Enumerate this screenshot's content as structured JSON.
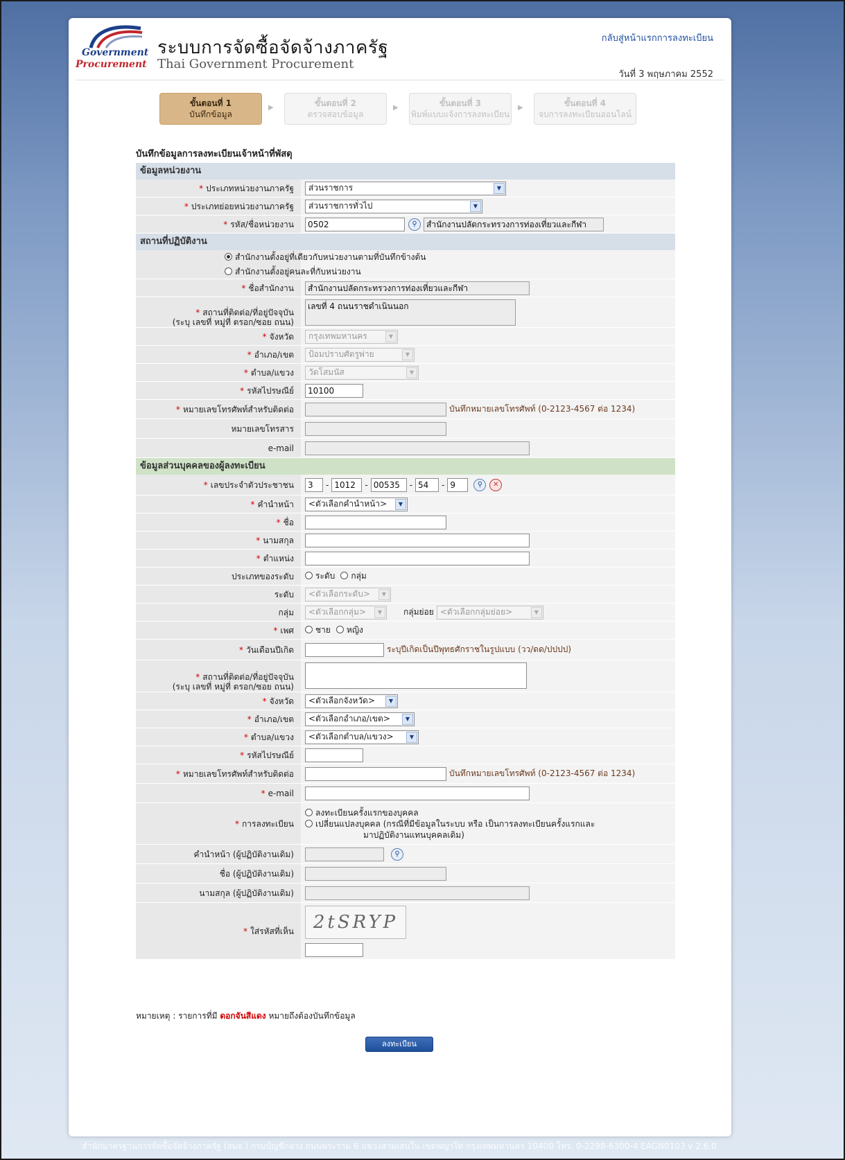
{
  "header": {
    "logo_line1": "Government",
    "logo_line2": "Procurement",
    "title_th": "ระบบการจัดซื้อจัดจ้างภาครัฐ",
    "title_en": "Thai Government Procurement",
    "back_link": "กลับสู่หน้าแรกการลงทะเบียน",
    "date": "วันที่ 3 พฤษภาคม 2552"
  },
  "steps": [
    {
      "title": "ขั้นตอนที่ 1",
      "sub": "บันทึกข้อมูล"
    },
    {
      "title": "ขั้นตอนที่ 2",
      "sub": "ตรวจสอบข้อมูล"
    },
    {
      "title": "ขั้นตอนที่ 3",
      "sub": "พิมพ์แบบแจ้งการลงทะเบียน"
    },
    {
      "title": "ขั้นตอนที่ 4",
      "sub": "จบการลงทะเบียนออนไลน์"
    }
  ],
  "form_title": "บันทึกข้อมูลการลงทะเบียนเจ้าหน้าที่พัสดุ",
  "agency": {
    "section": "ข้อมูลหน่วยงาน",
    "type_label": "ประเภทหน่วยงานภาครัฐ",
    "type_value": "ส่วนราชการ",
    "subtype_label": "ประเภทย่อยหน่วยงานภาครัฐ",
    "subtype_value": "ส่วนราชการทั่วไป",
    "code_label": "รหัส/ชื่อหน่วยงาน",
    "code_value": "0502",
    "name_value": "สำนักงานปลัดกระทรวงการท่องเที่ยวและกีฬา"
  },
  "office": {
    "section": "สถานที่ปฏิบัติงาน",
    "radio1": "สำนักงานตั้งอยู่ที่เดียวกับหน่วยงานตามที่บันทึกข้างต้น",
    "radio2": "สำนักงานตั้งอยู่คนละที่กับหน่วยงาน",
    "name_label": "ชื่อสำนักงาน",
    "name_value": "สำนักงานปลัดกระทรวงการท่องเที่ยวและกีฬา",
    "addr_label": "สถานที่ติดต่อ/ที่อยู่ปัจจุบัน",
    "addr_label2": "(ระบุ เลขที่ หมู่ที่ ตรอก/ซอย ถนน)",
    "addr_value": "เลขที่ 4  ถนนราชดำเนินนอก",
    "province_label": "จังหวัด",
    "province_value": "กรุงเทพมหานคร",
    "district_label": "อำเภอ/เขต",
    "district_value": "ป้อมปราบศัตรูพ่าย",
    "subdistrict_label": "ตำบล/แขวง",
    "subdistrict_value": "วัดโสมนัส",
    "zip_label": "รหัสไปรษณีย์",
    "zip_value": "10100",
    "phone_label": "หมายเลขโทรศัพท์สำหรับติดต่อ",
    "phone_hint": "บันทึกหมายเลขโทรศัพท์ (0-2123-4567 ต่อ 1234)",
    "fax_label": "หมายเลขโทรสาร",
    "email_label": "e-mail"
  },
  "person": {
    "section": "ข้อมูลส่วนบุคคลของผู้ลงทะเบียน",
    "id_label": "เลขประจำตัวประชาชน",
    "id_parts": [
      "3",
      "1012",
      "00535",
      "54",
      "9"
    ],
    "prefix_label": "คำนำหน้า",
    "prefix_value": "<ตัวเลือกคำนำหน้า>",
    "first_label": "ชื่อ",
    "last_label": "นามสกุล",
    "position_label": "ตำแหน่ง",
    "level_type_label": "ประเภทของระดับ",
    "level_type_opt1": "ระดับ",
    "level_type_opt2": "กลุ่ม",
    "level_label": "ระดับ",
    "level_value": "<ตัวเลือกระดับ>",
    "group_label": "กลุ่ม",
    "group_value": "<ตัวเลือกกลุ่ม>",
    "subgroup_label": "กลุ่มย่อย",
    "subgroup_value": "<ตัวเลือกกลุ่มย่อย>",
    "gender_label": "เพศ",
    "gender_opt1": "ชาย",
    "gender_opt2": "หญิง",
    "dob_label": "วันเดือนปีเกิด",
    "dob_hint": "ระบุปีเกิดเป็นปีพุทธศักราชในรูปแบบ (วว/ดด/ปปปป)",
    "addr_label": "สถานที่ติดต่อ/ที่อยู่ปัจจุบัน",
    "addr_label2": "(ระบุ เลขที่ หมู่ที่ ตรอก/ซอย ถนน)",
    "province_label": "จังหวัด",
    "province_value": "<ตัวเลือกจังหวัด>",
    "district_label": "อำเภอ/เขต",
    "district_value": "<ตัวเลือกอำเภอ/เขต>",
    "subdistrict_label": "ตำบล/แขวง",
    "subdistrict_value": "<ตัวเลือกตำบล/แขวง>",
    "zip_label": "รหัสไปรษณีย์",
    "phone_label": "หมายเลขโทรศัพท์สำหรับติดต่อ",
    "phone_hint": "บันทึกหมายเลขโทรศัพท์ (0-2123-4567 ต่อ 1234)",
    "email_label": "e-mail",
    "reg_label": "การลงทะเบียน",
    "reg_opt1": "ลงทะเบียนครั้งแรกของบุคคล",
    "reg_opt2": "เปลี่ยนแปลงบุคคล (กรณีที่มีข้อมูลในระบบ หรือ เป็นการลงทะเบียนครั้งแรกและ",
    "reg_opt2b": "มาปฏิบัติงานแทนบุคคลเดิม)",
    "old_prefix_label": "คำนำหน้า (ผู้ปฏิบัติงานเดิม)",
    "old_first_label": "ชื่อ (ผู้ปฏิบัติงานเดิม)",
    "old_last_label": "นามสกุล (ผู้ปฏิบัติงานเดิม)",
    "captcha_label": "ใส่รหัสที่เห็น",
    "captcha_text": "2tSRYP"
  },
  "note_prefix": "หมายเหตุ : รายการที่มี",
  "note_red": "ดอกจันสีแดง",
  "note_suffix": "หมายถึงต้องบันทึกข้อมูล",
  "submit_label": "ลงทะเบียน",
  "footer": "สำนักมาตรฐานการจัดซื้อจัดจ้างภาครัฐ (สมจ.) กรมบัญชีกลาง ถนนพระราม 6 แขวงสามเสนใน เขตพญาไท กรุงเทพมหานคร 10400 โทร. 0-2298-6300-4     EAGN0103 v 2.6.0",
  "required_mark": "*",
  "icons": {
    "search": "search-icon",
    "clear": "clear-icon",
    "dropdown": "chevron-down-icon"
  }
}
